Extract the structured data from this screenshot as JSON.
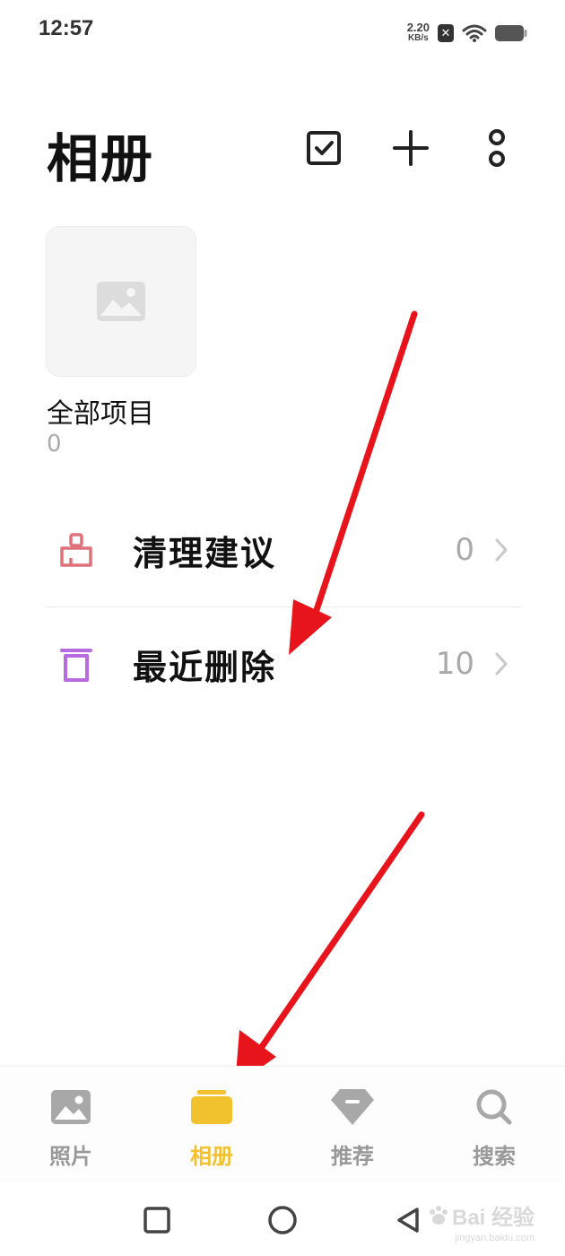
{
  "status_bar": {
    "time": "12:57",
    "net_speed_value": "2.20",
    "net_speed_unit": "KB/s",
    "sim_icon": "no-sim-icon",
    "wifi_icon": "wifi-icon",
    "battery_icon": "battery-icon"
  },
  "header": {
    "title": "相册",
    "actions": [
      "checkbox-select-icon",
      "plus-icon",
      "more-vertical-icon"
    ]
  },
  "albums": [
    {
      "name": "全部项目",
      "count": "0",
      "thumb_icon": "image-placeholder-icon"
    }
  ],
  "list": {
    "clean": {
      "label": "清理建议",
      "count": "0",
      "icon": "broom-icon"
    },
    "deleted": {
      "label": "最近删除",
      "count": "10",
      "icon": "trash-icon"
    }
  },
  "tabs": {
    "photos": {
      "label": "照片",
      "icon": "photo-icon"
    },
    "albums": {
      "label": "相册",
      "icon": "album-folder-icon",
      "active": true
    },
    "recommend": {
      "label": "推荐",
      "icon": "diamond-icon"
    },
    "search": {
      "label": "搜索",
      "icon": "search-icon"
    }
  },
  "system_nav": [
    "square-icon",
    "circle-icon",
    "triangle-back-icon"
  ],
  "watermark": {
    "text": "Bai 经验",
    "sub": "jingyan.baidu.com"
  },
  "colors": {
    "accent": "#f2c12e",
    "clean_icon": "#e0707a",
    "trash_icon": "#b86be0",
    "annotation_arrow": "#e8141c",
    "muted_text": "#aaaaaa"
  }
}
